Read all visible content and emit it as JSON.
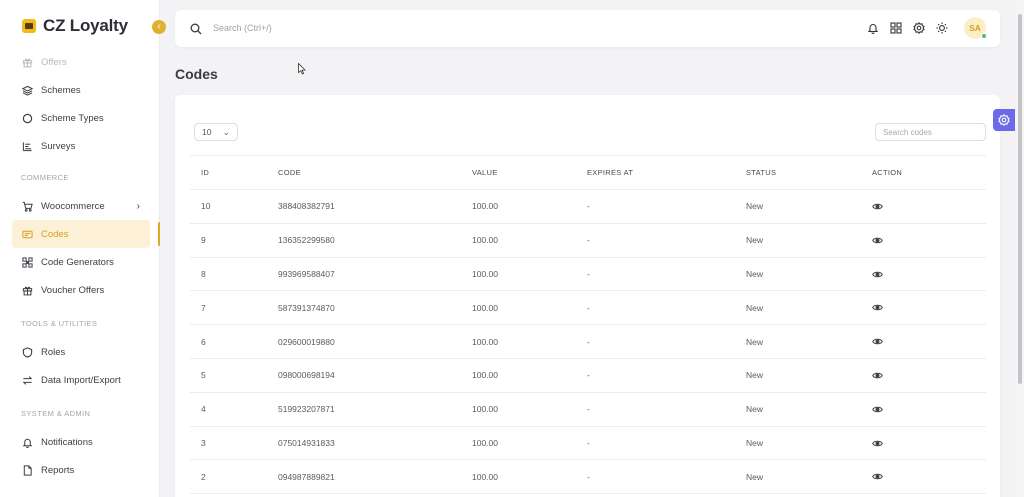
{
  "brand": {
    "name": "CZ Loyalty"
  },
  "sidebar": {
    "items": [
      {
        "label": "Offers",
        "icon": "gift-icon",
        "faded": true
      },
      {
        "label": "Schemes",
        "icon": "layers-icon"
      },
      {
        "label": "Scheme Types",
        "icon": "circle-icon"
      },
      {
        "label": "Surveys",
        "icon": "list-chart-icon"
      }
    ],
    "commerce_label": "COMMERCE",
    "commerce": [
      {
        "label": "Woocommerce",
        "icon": "cart-icon",
        "chevron": "›"
      },
      {
        "label": "Codes",
        "icon": "code-card-icon",
        "active": true
      },
      {
        "label": "Code Generators",
        "icon": "qr-icon"
      },
      {
        "label": "Voucher Offers",
        "icon": "gift-icon"
      }
    ],
    "tools_label": "TOOLS & UTILITIES",
    "tools": [
      {
        "label": "Roles",
        "icon": "shield-icon"
      },
      {
        "label": "Data Import/Export",
        "icon": "swap-icon"
      }
    ],
    "system_label": "SYSTEM & ADMIN",
    "system": [
      {
        "label": "Notifications",
        "icon": "bell-icon"
      },
      {
        "label": "Reports",
        "icon": "file-icon"
      }
    ]
  },
  "topbar": {
    "search_placeholder": "Search (Ctrl+/)",
    "avatar_initials": "SA"
  },
  "page": {
    "title": "Codes"
  },
  "table": {
    "page_size": "10",
    "search_placeholder": "Search codes",
    "headers": {
      "id": "ID",
      "code": "CODE",
      "value": "VALUE",
      "expires": "EXPIRES AT",
      "status": "STATUS",
      "action": "ACTION"
    },
    "rows": [
      {
        "id": "10",
        "code": "388408382791",
        "value": "100.00",
        "expires": "-",
        "status": "New"
      },
      {
        "id": "9",
        "code": "136352299580",
        "value": "100.00",
        "expires": "-",
        "status": "New"
      },
      {
        "id": "8",
        "code": "993969588407",
        "value": "100.00",
        "expires": "-",
        "status": "New"
      },
      {
        "id": "7",
        "code": "587391374870",
        "value": "100.00",
        "expires": "-",
        "status": "New"
      },
      {
        "id": "6",
        "code": "029600019880",
        "value": "100.00",
        "expires": "-",
        "status": "New"
      },
      {
        "id": "5",
        "code": "098000698194",
        "value": "100.00",
        "expires": "-",
        "status": "New"
      },
      {
        "id": "4",
        "code": "519923207871",
        "value": "100.00",
        "expires": "-",
        "status": "New"
      },
      {
        "id": "3",
        "code": "075014931833",
        "value": "100.00",
        "expires": "-",
        "status": "New"
      },
      {
        "id": "2",
        "code": "094987889821",
        "value": "100.00",
        "expires": "-",
        "status": "New"
      }
    ]
  },
  "colors": {
    "accent": "#e0a825",
    "active_bg": "#fcf0d6",
    "float_btn": "#6b6ae8"
  }
}
